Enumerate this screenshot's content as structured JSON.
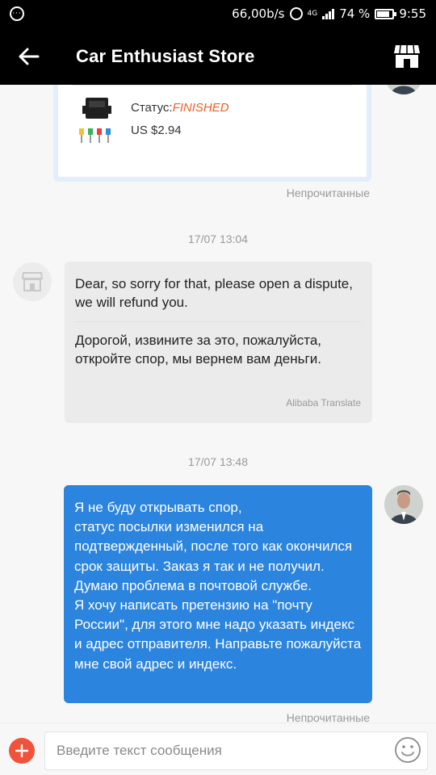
{
  "status_bar": {
    "net_speed": "66,00b/s",
    "network_type": "4G",
    "battery": "74 %",
    "time": "9:55"
  },
  "header": {
    "title": "Car Enthusiast Store",
    "back_icon": "arrow-left-icon",
    "store_icon": "store-icon"
  },
  "order_card": {
    "status_label": "Статус:",
    "status_value": "FINISHED",
    "price": "US $2.94",
    "status_color": "#ec5f23"
  },
  "messages": [
    {
      "unread_label": "Непрочитанные"
    },
    {
      "timestamp": "17/07 13:04",
      "original": "Dear, so sorry for that, please open a dispute, we will refund you.",
      "translated": "Дорогой, извините за это, пожалуйста, откройте спор, мы вернем вам деньги.",
      "translate_credit": "Alibaba Translate"
    },
    {
      "timestamp": "17/07 13:48",
      "text": "Я не буду открывать спор,\nстатус посылки изменился на подтвержденный, после того как окончился срок защиты. Заказ я так и не получил. Думаю проблема в почтовой службе.\nЯ хочу написать претензию на \"почту России\", для этого мне надо указать индекс и адрес отправителя. Направьте пожалуйста мне свой адрес и индекс.",
      "unread_label": "Непрочитанные"
    }
  ],
  "input": {
    "placeholder": "Введите текст сообщения"
  },
  "colors": {
    "header_bg": "#000000",
    "outgoing_bubble": "#2b84dd",
    "incoming_bubble": "#ebebeb",
    "add_button": "#f0533c"
  }
}
